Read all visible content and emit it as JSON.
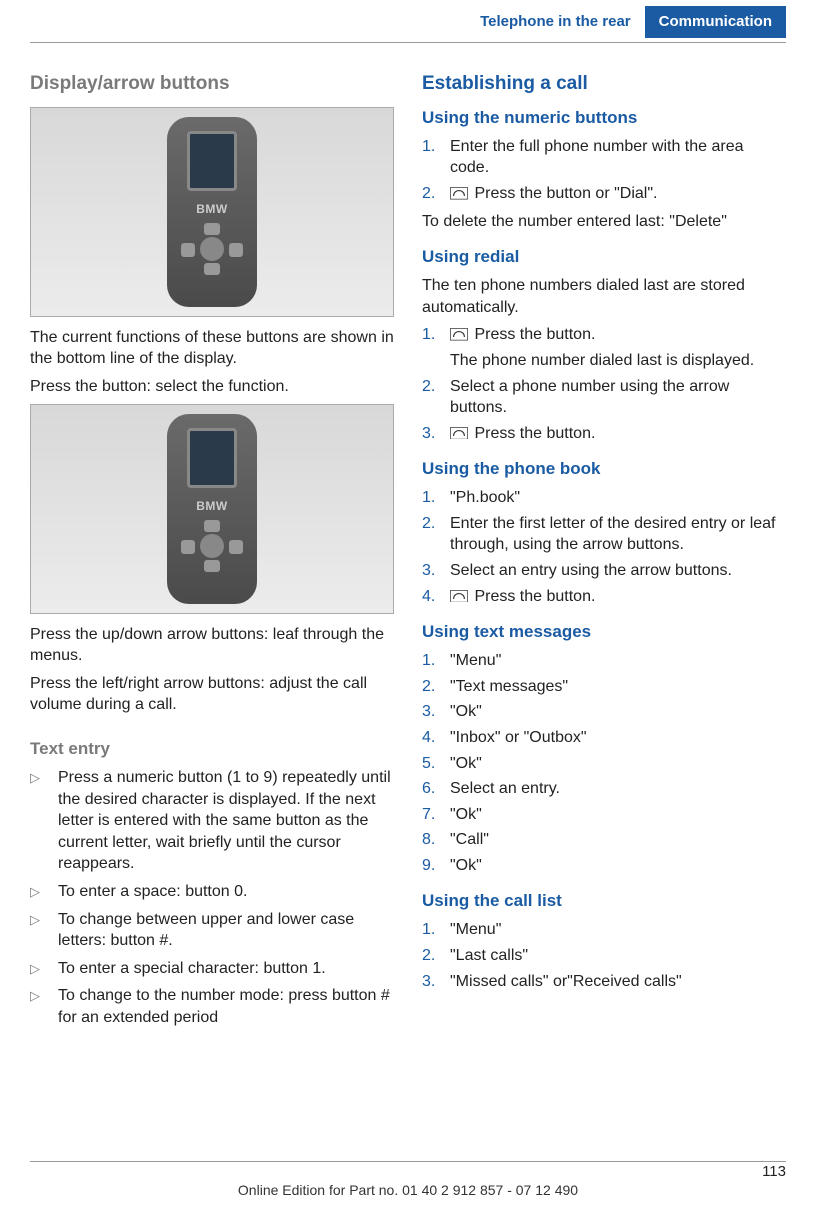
{
  "header": {
    "tab_inactive": "Telephone in the rear",
    "tab_active": "Communication"
  },
  "page_number": "113",
  "footer": "Online Edition for Part no. 01 40 2 912 857 - 07 12 490",
  "phone_brand": "BMW",
  "left": {
    "h1": "Display/arrow buttons",
    "p1": "The current functions of these buttons are shown in the bottom line of the display.",
    "p2": "Press the button: select the function.",
    "p3": "Press the up/down arrow buttons: leaf through the menus.",
    "p4": "Press the left/right arrow buttons: adjust the call volume during a call.",
    "h2": "Text entry",
    "bullets": [
      "Press a numeric button (1 to 9) repeatedly until the desired character is displayed. If the next letter is entered with the same button as the current letter, wait briefly until the cursor reappears.",
      "To enter a space: button 0.",
      "To change between upper and lower case letters: button #.",
      "To enter a special character: button 1.",
      "To change to the number mode: press button # for an extended period"
    ]
  },
  "right": {
    "h1": "Establishing a call",
    "sec1": {
      "h": "Using the numeric buttons",
      "s1": "Enter the full phone number with the area code.",
      "s2": "Press the button or \"Dial\".",
      "p": "To delete the number entered last: \"Delete\""
    },
    "sec2": {
      "h": "Using redial",
      "intro": "The ten phone numbers dialed last are stored automatically.",
      "s1a": "Press the button.",
      "s1b": "The phone number dialed last is displayed.",
      "s2": "Select a phone number using the arrow buttons.",
      "s3": "Press the button."
    },
    "sec3": {
      "h": "Using the phone book",
      "s1": "\"Ph.book\"",
      "s2": "Enter the first letter of the desired entry or leaf through, using the arrow buttons.",
      "s3": "Select an entry using the arrow buttons.",
      "s4": "Press the button."
    },
    "sec4": {
      "h": "Using text messages",
      "steps": [
        "\"Menu\"",
        "\"Text messages\"",
        "\"Ok\"",
        "\"Inbox\" or \"Outbox\"",
        "\"Ok\"",
        "Select an entry.",
        "\"Ok\"",
        "\"Call\"",
        "\"Ok\""
      ]
    },
    "sec5": {
      "h": "Using the call list",
      "steps": [
        "\"Menu\"",
        "\"Last calls\"",
        "\"Missed calls\" or\"Received calls\""
      ]
    }
  }
}
